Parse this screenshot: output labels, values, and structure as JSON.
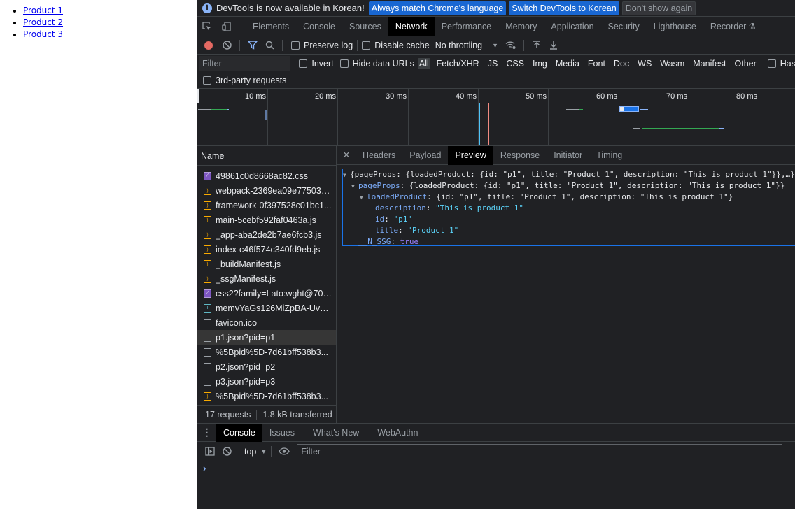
{
  "page": {
    "links": [
      "Product 1",
      "Product 2",
      "Product 3"
    ]
  },
  "infobar": {
    "message": "DevTools is now available in Korean!",
    "btn_match": "Always match Chrome's language",
    "btn_switch": "Switch DevTools to Korean",
    "btn_dismiss": "Don't show again"
  },
  "main_tabs": [
    "Elements",
    "Console",
    "Sources",
    "Network",
    "Performance",
    "Memory",
    "Application",
    "Security",
    "Lighthouse",
    "Recorder"
  ],
  "active_main_tab": "Network",
  "toolbar": {
    "preserve_log": "Preserve log",
    "disable_cache": "Disable cache",
    "throttling": "No throttling"
  },
  "filterbar": {
    "placeholder": "Filter",
    "invert": "Invert",
    "hide_data_urls": "Hide data URLs",
    "types": [
      "All",
      "Fetch/XHR",
      "JS",
      "CSS",
      "Img",
      "Media",
      "Font",
      "Doc",
      "WS",
      "Wasm",
      "Manifest",
      "Other"
    ],
    "has_blocked": "Has"
  },
  "third_party": "3rd-party requests",
  "timeline": {
    "ticks": [
      "10 ms",
      "20 ms",
      "30 ms",
      "40 ms",
      "50 ms",
      "60 ms",
      "70 ms",
      "80 ms"
    ]
  },
  "requests": {
    "header": "Name",
    "items": [
      {
        "name": "49861c0d8668ac82.css",
        "type": "css"
      },
      {
        "name": "webpack-2369ea09e775031...",
        "type": "js"
      },
      {
        "name": "framework-0f397528c01bc1...",
        "type": "js"
      },
      {
        "name": "main-5cebf592faf0463a.js",
        "type": "js"
      },
      {
        "name": "_app-aba2de2b7ae6fcb3.js",
        "type": "js"
      },
      {
        "name": "index-c46f574c340fd9eb.js",
        "type": "js"
      },
      {
        "name": "_buildManifest.js",
        "type": "js"
      },
      {
        "name": "_ssgManifest.js",
        "type": "js"
      },
      {
        "name": "css2?family=Lato:wght@700...",
        "type": "css"
      },
      {
        "name": "memvYaGs126MiZpBA-UvW...",
        "type": "font"
      },
      {
        "name": "favicon.ico",
        "type": "doc"
      },
      {
        "name": "p1.json?pid=p1",
        "type": "doc"
      },
      {
        "name": "%5Bpid%5D-7d61bff538b3...",
        "type": "doc"
      },
      {
        "name": "p2.json?pid=p2",
        "type": "doc"
      },
      {
        "name": "p3.json?pid=p3",
        "type": "doc"
      },
      {
        "name": "%5Bpid%5D-7d61bff538b3...",
        "type": "js"
      }
    ],
    "selected_index": 11,
    "summary_requests": "17 requests",
    "summary_transferred": "1.8 kB transferred"
  },
  "detail_tabs": [
    "Headers",
    "Payload",
    "Preview",
    "Response",
    "Initiator",
    "Timing"
  ],
  "active_detail_tab": "Preview",
  "preview": {
    "l1_open": "{pageProps: {loadedProduct: {id: \"p1\", title: \"Product 1\", description: \"This is product 1\"}},…}",
    "l2_key": "pageProps",
    "l2_val": "{loadedProduct: {id: \"p1\", title: \"Product 1\", description: \"This is product 1\"}}",
    "l3_key": "loadedProduct",
    "l3_val": "{id: \"p1\", title: \"Product 1\", description: \"This is product 1\"}",
    "desc_key": "description",
    "desc_val": "\"This is product 1\"",
    "id_key": "id",
    "id_val": "\"p1\"",
    "title_key": "title",
    "title_val": "\"Product 1\"",
    "ssg_key": "__N_SSG",
    "ssg_val": "true"
  },
  "drawer_tabs": [
    "Console",
    "Issues",
    "What's New",
    "WebAuthn"
  ],
  "active_drawer_tab": "Console",
  "console": {
    "context": "top",
    "filter_placeholder": "Filter",
    "prompt": "›"
  }
}
